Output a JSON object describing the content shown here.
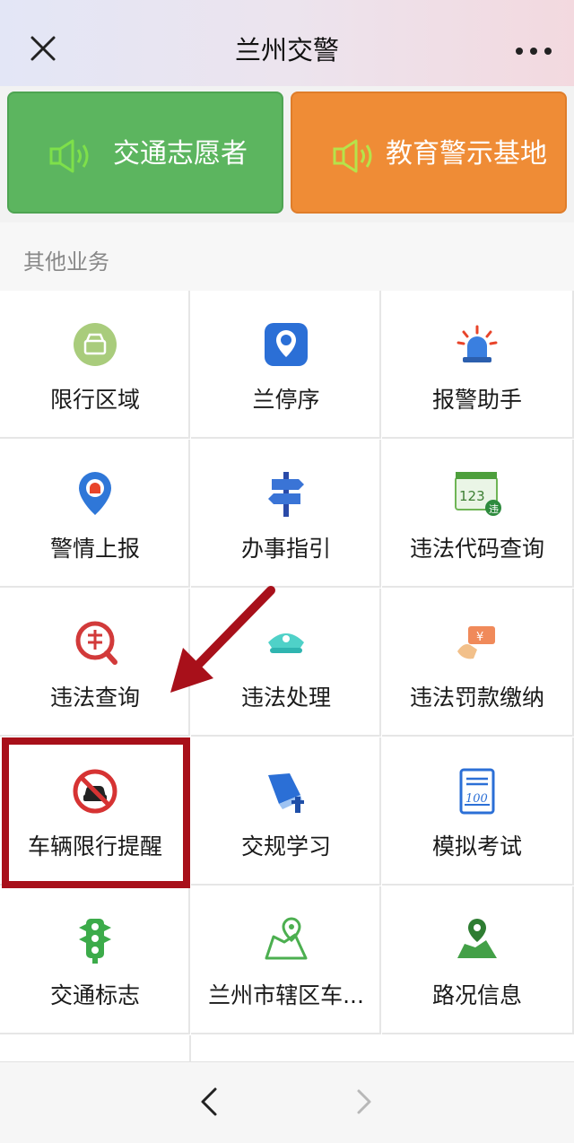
{
  "header": {
    "title": "兰州交警",
    "close_icon": "close-icon",
    "more_icon": "more-icon"
  },
  "banners": [
    {
      "label": "交通志愿者",
      "color": "#5cb55f",
      "icon": "speaker-icon"
    },
    {
      "label": "教育警示基地",
      "color": "#ef8c36",
      "icon": "speaker-icon"
    }
  ],
  "section": {
    "title": "其他业务"
  },
  "services": [
    {
      "label": "限行区域",
      "icon": "restricted-area-icon"
    },
    {
      "label": "兰停序",
      "icon": "parking-app-icon"
    },
    {
      "label": "报警助手",
      "icon": "alarm-light-icon"
    },
    {
      "label": "警情上报",
      "icon": "location-alert-icon"
    },
    {
      "label": "办事指引",
      "icon": "signpost-icon"
    },
    {
      "label": "违法代码查询",
      "icon": "violation-code-icon"
    },
    {
      "label": "违法查询",
      "icon": "violation-search-icon"
    },
    {
      "label": "违法处理",
      "icon": "police-cap-icon"
    },
    {
      "label": "违法罚款缴纳",
      "icon": "fine-payment-icon"
    },
    {
      "label": "车辆限行提醒",
      "icon": "no-car-icon"
    },
    {
      "label": "交规学习",
      "icon": "study-book-icon"
    },
    {
      "label": "模拟考试",
      "icon": "exam-paper-icon"
    },
    {
      "label": "交通标志",
      "icon": "traffic-light-icon"
    },
    {
      "label": "兰州市辖区车...",
      "icon": "map-pin-icon"
    },
    {
      "label": "路况信息",
      "icon": "road-map-icon"
    }
  ],
  "exam_icon_text": "100",
  "violation_icon_text": "123",
  "violation_badge_text": "违",
  "fine_icon_text": "¥",
  "bottom_nav": {
    "back_icon": "chevron-left-icon",
    "forward_icon": "chevron-right-icon"
  },
  "highlight": {
    "color": "#a8101a",
    "target": "车辆限行提醒"
  }
}
